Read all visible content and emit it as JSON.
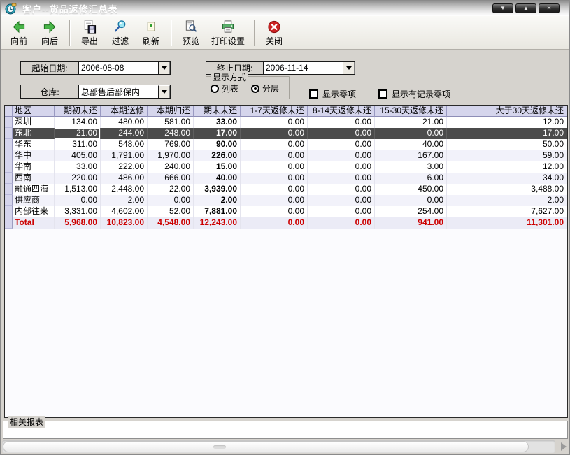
{
  "window": {
    "title": "客户--货品返修汇总表",
    "controls": [
      {
        "name": "minimize",
        "glyph": "▼"
      },
      {
        "name": "maximize",
        "glyph": "▲"
      },
      {
        "name": "close",
        "glyph": "✕"
      }
    ]
  },
  "toolbar": {
    "buttons": [
      {
        "label": "向前"
      },
      {
        "label": "向后"
      },
      {
        "label": "导出"
      },
      {
        "label": "过滤"
      },
      {
        "label": "刷新"
      },
      {
        "label": "预览"
      },
      {
        "label": "打印设置"
      },
      {
        "label": "关闭"
      }
    ]
  },
  "filters": {
    "start_date": {
      "label": "起始日期:",
      "value": "2006-08-08"
    },
    "end_date": {
      "label": "终止日期:",
      "value": "2006-11-14"
    },
    "warehouse": {
      "label": "仓库:",
      "value": "总部售后部保内"
    },
    "display_mode": {
      "title": "显示方式",
      "options": [
        {
          "label": "列表",
          "selected": false
        },
        {
          "label": "分层",
          "selected": true
        }
      ]
    },
    "show_zero": {
      "label": "显示零项",
      "checked": false
    },
    "show_recorded_zero": {
      "label": "显示有记录零项",
      "checked": false
    }
  },
  "table": {
    "columns": [
      "地区",
      "期初未还",
      "本期送修",
      "本期归还",
      "期末未还",
      "1-7天返修未还",
      "8-14天返修未还",
      "15-30天返修未还",
      "大于30天返修未还"
    ],
    "selected_row": "东北",
    "rows": [
      {
        "cells": [
          "深圳",
          "134.00",
          "480.00",
          "581.00",
          "33.00",
          "0.00",
          "0.00",
          "21.00",
          "12.00"
        ]
      },
      {
        "cells": [
          "东北",
          "21.00",
          "244.00",
          "248.00",
          "17.00",
          "0.00",
          "0.00",
          "0.00",
          "17.00"
        ],
        "selected": true
      },
      {
        "cells": [
          "华东",
          "311.00",
          "548.00",
          "769.00",
          "90.00",
          "0.00",
          "0.00",
          "40.00",
          "50.00"
        ]
      },
      {
        "cells": [
          "华中",
          "405.00",
          "1,791.00",
          "1,970.00",
          "226.00",
          "0.00",
          "0.00",
          "167.00",
          "59.00"
        ]
      },
      {
        "cells": [
          "华南",
          "33.00",
          "222.00",
          "240.00",
          "15.00",
          "0.00",
          "0.00",
          "3.00",
          "12.00"
        ]
      },
      {
        "cells": [
          "西南",
          "220.00",
          "486.00",
          "666.00",
          "40.00",
          "0.00",
          "0.00",
          "6.00",
          "34.00"
        ]
      },
      {
        "cells": [
          "融通四海",
          "1,513.00",
          "2,448.00",
          "22.00",
          "3,939.00",
          "0.00",
          "0.00",
          "450.00",
          "3,488.00"
        ]
      },
      {
        "cells": [
          "供应商",
          "0.00",
          "2.00",
          "0.00",
          "2.00",
          "0.00",
          "0.00",
          "0.00",
          "2.00"
        ]
      },
      {
        "cells": [
          "内部往来",
          "3,331.00",
          "4,602.00",
          "52.00",
          "7,881.00",
          "0.00",
          "0.00",
          "254.00",
          "7,627.00"
        ]
      },
      {
        "cells": [
          "Total",
          "5,968.00",
          "10,823.00",
          "4,548.00",
          "12,243.00",
          "0.00",
          "0.00",
          "941.00",
          "11,301.00"
        ],
        "total": true
      }
    ]
  },
  "related_reports": {
    "title": "相关报表"
  },
  "colors": {
    "header_bg": "#d5d5ec",
    "selected_row_bg": "#4b4b4b",
    "total_text": "#cc0000",
    "close_red": "#cc2222",
    "window_bg": "#d6d3ce"
  }
}
